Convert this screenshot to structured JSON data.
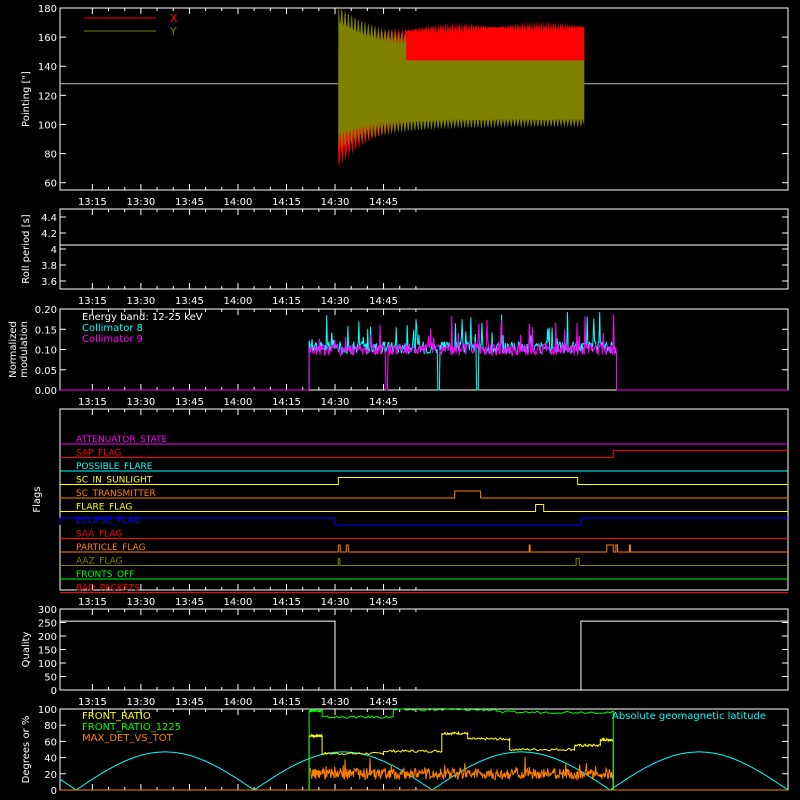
{
  "chart_data": [
    {
      "id": "pointing",
      "type": "line",
      "ylabel": "Pointing [\"]",
      "ylim": [
        55,
        180
      ],
      "yticks": [
        60,
        80,
        100,
        120,
        140,
        160,
        180
      ],
      "time_ticks": [
        "13:15",
        "13:30",
        "13:45",
        "14:00",
        "14:15",
        "14:30",
        "14:45"
      ],
      "xlim_min": [
        65,
        290
      ],
      "reference_line": 128,
      "legend": {
        "placement": "top-left",
        "entries": [
          {
            "name": "X",
            "color": "#ff0000"
          },
          {
            "name": "Y",
            "color": "#808000"
          }
        ]
      },
      "series": [
        {
          "name": "X",
          "color": "#ff0000",
          "start_min": 151,
          "end_min": 227,
          "envelope_start": [
            76,
            150
          ],
          "envelope_end": [
            108,
            165
          ]
        },
        {
          "name": "Y",
          "color": "#808000",
          "start_min": 151,
          "end_min": 227,
          "envelope_start": [
            88,
            176
          ],
          "envelope_end": [
            101,
            155
          ]
        }
      ]
    },
    {
      "id": "roll",
      "type": "line",
      "ylabel": "Roll period [s]",
      "ylim": [
        3.5,
        4.5
      ],
      "yticks": [
        3.6,
        3.8,
        4.0,
        4.2,
        4.4
      ],
      "time_ticks": [
        "13:15",
        "13:30",
        "13:45",
        "14:00",
        "14:15",
        "14:30",
        "14:45"
      ],
      "series": [
        {
          "name": "Roll period",
          "color": "#ffffff",
          "y": 4.05
        }
      ]
    },
    {
      "id": "modulation",
      "type": "line",
      "ylabel_lines": [
        "Normalized",
        "modulation"
      ],
      "ylim": [
        0,
        0.2
      ],
      "yticks": [
        "0.00",
        "0.05",
        "0.10",
        "0.15",
        "0.20"
      ],
      "ytick_values": [
        0,
        0.05,
        0.1,
        0.15,
        0.2
      ],
      "time_ticks": [
        "13:15",
        "13:30",
        "13:45",
        "14:00",
        "14:15",
        "14:30",
        "14:45"
      ],
      "legend_lines": [
        {
          "text": "Energy band: 12-25 keV",
          "color": "#ffffff"
        },
        {
          "text": "Collimator 8",
          "color": "#00ffff"
        },
        {
          "text": "Collimator 9",
          "color": "#ff00ff"
        }
      ],
      "series": [
        {
          "name": "Collimator 8",
          "color": "#00ffff",
          "start_min": 142,
          "end_min": 237,
          "level": 0.105,
          "dropouts_min": [
            182,
            194
          ]
        },
        {
          "name": "Collimator 9",
          "color": "#ff00ff",
          "start_min": 142,
          "end_min": 237,
          "level": 0.1,
          "dropouts_min": [
            166
          ]
        }
      ]
    },
    {
      "id": "flags",
      "type": "line",
      "ylabel": "Flags",
      "time_ticks": [
        "13:15",
        "13:30",
        "13:45",
        "14:00",
        "14:15",
        "14:30",
        "14:45"
      ],
      "flags": [
        {
          "name": "ATTENUATOR_STATE",
          "color": "#ff00ff",
          "intervals": []
        },
        {
          "name": "SAP_FLAG",
          "color": "#ff0000",
          "intervals": [
            [
              236,
              290
            ]
          ]
        },
        {
          "name": "POSSIBLE_FLARE",
          "color": "#00ffff",
          "intervals": []
        },
        {
          "name": "SC_IN_SUNLIGHT",
          "color": "#ffff00",
          "intervals": [
            [
              151,
              225
            ]
          ]
        },
        {
          "name": "SC_TRANSMITTER",
          "color": "#ff8000",
          "intervals": [
            [
              187,
              195
            ]
          ]
        },
        {
          "name": "FLARE_FLAG",
          "color": "#ffff00",
          "intervals": [
            [
              212,
              214.5
            ]
          ]
        },
        {
          "name": "ECLIPSE_FLAG",
          "color": "#0000ff",
          "intervals": [
            [
              65,
              150
            ],
            [
              226,
              290
            ]
          ]
        },
        {
          "name": "SAA_FLAG",
          "color": "#ff0000",
          "intervals": []
        },
        {
          "name": "PARTICLE_FLAG",
          "color": "#ff8000",
          "intervals": [
            [
              151,
              151.6
            ],
            [
              153.5,
              154.1
            ],
            [
              210,
              210.3
            ],
            [
              234,
              236
            ],
            [
              236.8,
              237.3
            ],
            [
              241,
              241.3
            ]
          ]
        },
        {
          "name": "AAZ_FLAG",
          "color": "#808000",
          "intervals": [
            [
              151,
              151.5
            ],
            [
              224.5,
              225.5
            ]
          ]
        },
        {
          "name": "FRONTS_OFF",
          "color": "#00ff00",
          "intervals": []
        },
        {
          "name": "BAD_PACKETS",
          "color": "#ff0000",
          "intervals": []
        }
      ]
    },
    {
      "id": "quality",
      "type": "line",
      "ylabel": "Quality",
      "ylim": [
        0,
        300
      ],
      "yticks": [
        0,
        50,
        100,
        150,
        200,
        250,
        300
      ],
      "time_ticks": [
        "13:15",
        "13:30",
        "13:45",
        "14:00",
        "14:15",
        "14:30",
        "14:45"
      ],
      "series": [
        {
          "name": "Quality",
          "color": "#ffffff",
          "high": 255,
          "high_intervals": [
            [
              65,
              150
            ],
            [
              226,
              290
            ]
          ]
        }
      ]
    },
    {
      "id": "ratios",
      "type": "line",
      "ylabel": "Degrees or %",
      "ylim": [
        0,
        100
      ],
      "yticks": [
        0,
        20,
        40,
        60,
        80,
        100
      ],
      "time_ticks": [],
      "legend_lines": [
        {
          "text": "FRONT_RATIO",
          "color": "#ffff00"
        },
        {
          "text": "FRONT_RATIO_1225",
          "color": "#00ff00"
        },
        {
          "text": "MAX_DET_VS_TOT",
          "color": "#ff8000"
        }
      ],
      "annotation": {
        "text": "Absolute geomagnetic latitude",
        "color": "#00ffff"
      },
      "series": [
        {
          "name": "FRONT_RATIO",
          "color": "#ffff00",
          "segments": [
            [
              142,
              146,
              67
            ],
            [
              146,
              165,
              45
            ],
            [
              165,
              183,
              48
            ],
            [
              183,
              191,
              70
            ],
            [
              191,
              204,
              63
            ],
            [
              204,
              224,
              50
            ],
            [
              224,
              232,
              55
            ],
            [
              232,
              236,
              62
            ]
          ]
        },
        {
          "name": "FRONT_RATIO_1225",
          "color": "#00ff00",
          "segments": [
            [
              142,
              146,
              98
            ],
            [
              146,
              168,
              90
            ],
            [
              168,
              200,
              99
            ],
            [
              200,
              236,
              96
            ]
          ]
        },
        {
          "name": "MAX_DET_VS_TOT",
          "color": "#ff8000",
          "start_min": 142,
          "end_min": 236,
          "level": 20
        },
        {
          "name": "Absolute geomagnetic latitude",
          "color": "#00ffff",
          "lat_max": 47
        }
      ]
    }
  ]
}
